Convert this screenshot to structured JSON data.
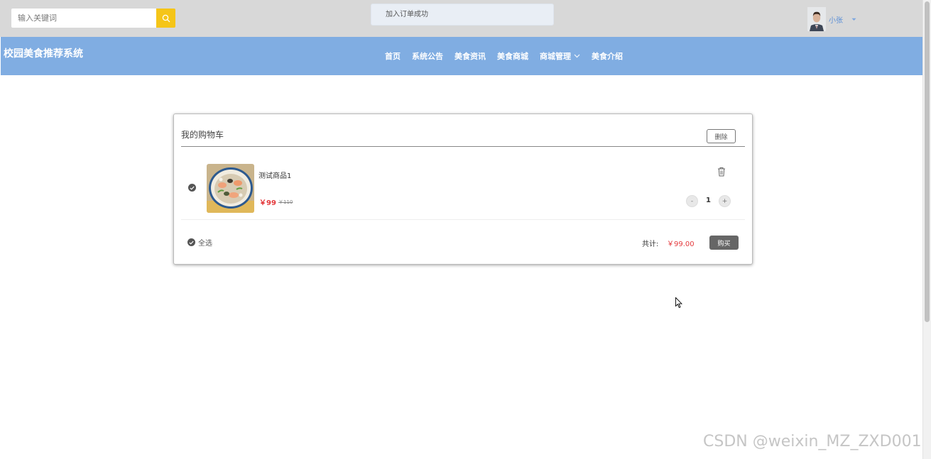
{
  "search": {
    "placeholder": "输入关键词",
    "button_icon": "search-icon"
  },
  "toast": {
    "message": "加入订单成功"
  },
  "user": {
    "name": "小张",
    "caret_icon": "caret-down-icon"
  },
  "brand": {
    "title": "校园美食推荐系统"
  },
  "nav": {
    "items": [
      {
        "label": "首页"
      },
      {
        "label": "系统公告"
      },
      {
        "label": "美食资讯"
      },
      {
        "label": "美食商城"
      },
      {
        "label": "商城管理",
        "has_dropdown": true
      },
      {
        "label": "美食介绍"
      }
    ]
  },
  "cart": {
    "title": "我的购物车",
    "delete_label": "删除",
    "items": [
      {
        "name": "测试商品1",
        "price": "￥99",
        "old_price": "￥110",
        "quantity": "1",
        "minus_label": "-",
        "plus_label": "+"
      }
    ],
    "select_all_label": "全选",
    "total_label": "共计:",
    "total_value": "￥99.00",
    "buy_label": "购买"
  },
  "watermark": {
    "text": "CSDN @weixin_MZ_ZXD001"
  },
  "colors": {
    "topbar": "#d8d8d8",
    "navbar": "#80ade2",
    "search_button": "#f5c518",
    "price": "#e4393c",
    "buy_button": "#666666"
  }
}
